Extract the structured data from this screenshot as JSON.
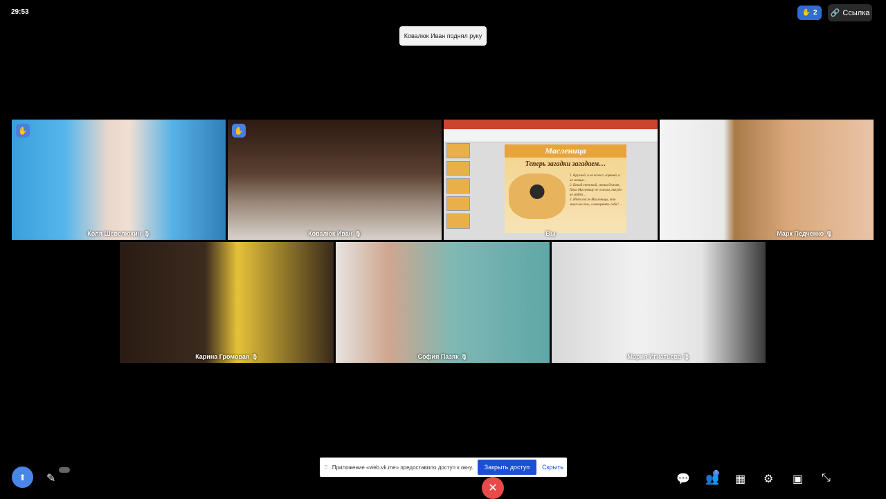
{
  "timer": "29:53",
  "raised_hands": {
    "count": "2"
  },
  "link_button": {
    "label": "Ссылка"
  },
  "toast": "Ковалюк Иван поднял руку",
  "participants": [
    {
      "name": "Коля Шевелюхин",
      "hand_raised": true
    },
    {
      "name": "Ковалюк Иван",
      "hand_raised": true
    },
    {
      "name": "Вы",
      "hand_raised": false
    },
    {
      "name": "Марк Педченко",
      "hand_raised": false
    },
    {
      "name": "Карина Громовая",
      "hand_raised": false
    },
    {
      "name": "София Пазяк",
      "hand_raised": false
    },
    {
      "name": "Мария Игнатьева",
      "hand_raised": false
    }
  ],
  "slide": {
    "title": "Масленица",
    "subtitle": "Теперь загадки загадаем…",
    "riddles": [
      "1. Круглый, а не колесо, горячий, а не солнце…",
      "2. Белый снежный, спеша бежит, Пока Масленицу не сожгли, никуда не уйдёт…",
      "3. Идёт после Масленицы, что много не ешь, а накормить себя?…"
    ]
  },
  "screen_share_notice": {
    "text": "Приложение «web.vk.me» предоставило доступ к окну.",
    "close_label": "Закрыть доступ",
    "hide_label": "Скрыть"
  },
  "participants_badge": "7",
  "icons": {
    "hand": "hand-icon",
    "link": "link-icon",
    "mic_off": "mic-off-icon",
    "chat": "chat-icon",
    "participants": "participants-icon",
    "layout": "layout-icon",
    "settings": "gear-icon",
    "pip": "pip-icon",
    "collapse": "collapse-icon"
  },
  "colors": {
    "accent": "#4a86e8",
    "end_call": "#e84a4a"
  }
}
